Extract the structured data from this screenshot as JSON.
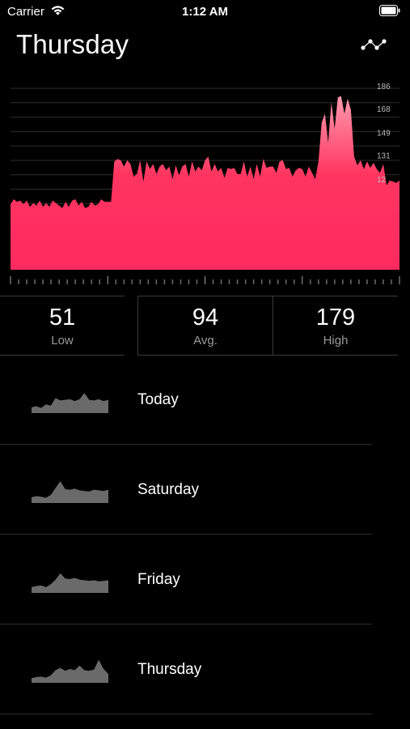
{
  "status_bar": {
    "carrier": "Carrier",
    "time": "1:12 AM",
    "wifi_icon": "wifi-icon",
    "battery_icon": "battery-icon"
  },
  "header": {
    "title": "Thursday",
    "options_icon": "sparkline-options-icon"
  },
  "chart_data": {
    "type": "area",
    "title": "",
    "xlabel": "",
    "ylabel": "",
    "fill_gradient": [
      "#ff2a5f",
      "#ff3560",
      "#ff9aad"
    ],
    "ylim": [
      40,
      190
    ],
    "yticks": [
      186,
      168,
      149,
      131,
      112
    ],
    "ytick_labels": [
      "186",
      "168",
      "149",
      "131",
      "12"
    ],
    "grid": true,
    "x": [
      0,
      1,
      2,
      3,
      4,
      5,
      6,
      7,
      8,
      9,
      10,
      11,
      12,
      13,
      14,
      15,
      16,
      17,
      18,
      19,
      20,
      21,
      22,
      23,
      24,
      25,
      26,
      27,
      28,
      29,
      30,
      31,
      32,
      33,
      34,
      35,
      36,
      37,
      38,
      39,
      40,
      41,
      42,
      43,
      44,
      45,
      46,
      47,
      48,
      49,
      50,
      51,
      52,
      53,
      54,
      55,
      56,
      57,
      58,
      59,
      60,
      61,
      62,
      63,
      64,
      65,
      66,
      67,
      68,
      69,
      70,
      71,
      72,
      73,
      74,
      75,
      76,
      77,
      78,
      79,
      80,
      81,
      82,
      83,
      84,
      85,
      86,
      87,
      88,
      89,
      90,
      91,
      92,
      93,
      94,
      95,
      96,
      97,
      98,
      99,
      100,
      101,
      102,
      103,
      104,
      105,
      106,
      107,
      108,
      109,
      110,
      111,
      112,
      113,
      114,
      115,
      116,
      117,
      118,
      119,
      120
    ],
    "values": [
      92,
      96,
      94,
      95,
      92,
      95,
      90,
      93,
      91,
      95,
      90,
      93,
      90,
      95,
      93,
      91,
      89,
      94,
      90,
      95,
      96,
      91,
      94,
      89,
      90,
      94,
      91,
      92,
      96,
      94,
      94,
      94,
      126,
      128,
      127,
      122,
      127,
      124,
      114,
      116,
      127,
      110,
      126,
      120,
      124,
      116,
      122,
      124,
      119,
      122,
      112,
      123,
      115,
      122,
      124,
      114,
      126,
      118,
      122,
      119,
      127,
      130,
      118,
      124,
      118,
      121,
      113,
      121,
      120,
      121,
      116,
      116,
      126,
      114,
      122,
      112,
      124,
      114,
      128,
      121,
      122,
      122,
      117,
      126,
      127,
      120,
      121,
      114,
      119,
      121,
      120,
      114,
      122,
      117,
      112,
      126,
      157,
      164,
      141,
      173,
      152,
      177,
      178,
      164,
      176,
      167,
      130,
      123,
      127,
      120,
      126,
      121,
      125,
      120,
      117,
      124,
      107,
      111,
      110,
      109,
      111
    ],
    "x_ticks_major": 4
  },
  "stats": {
    "low": {
      "value": "51",
      "label": "Low"
    },
    "avg": {
      "value": "94",
      "label": "Avg."
    },
    "high": {
      "value": "179",
      "label": "High"
    }
  },
  "days": [
    {
      "label": "Today",
      "spark": [
        50,
        52,
        49,
        55,
        53,
        66,
        62,
        63,
        64,
        61,
        64,
        75,
        63,
        62,
        64,
        61,
        63
      ]
    },
    {
      "label": "Saturday",
      "spark": [
        50,
        52,
        51,
        49,
        54,
        66,
        78,
        64,
        63,
        65,
        62,
        61,
        60,
        63,
        62,
        61,
        63
      ]
    },
    {
      "label": "Friday",
      "spark": [
        50,
        52,
        53,
        50,
        55,
        63,
        74,
        65,
        64,
        66,
        63,
        62,
        61,
        62,
        60,
        61,
        62
      ]
    },
    {
      "label": "Thursday",
      "spark": [
        48,
        50,
        51,
        49,
        53,
        62,
        66,
        61,
        64,
        62,
        70,
        62,
        61,
        63,
        80,
        64,
        55
      ]
    }
  ]
}
